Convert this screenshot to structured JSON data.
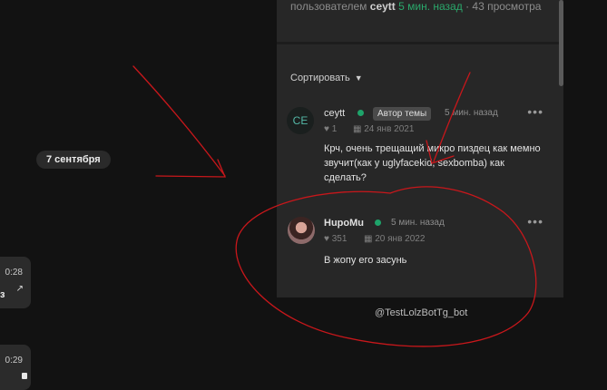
{
  "chat": {
    "date_label": "7 сентября",
    "messages": [
      {
        "time": "0:28",
        "fragment": "з",
        "arrow": "↗"
      },
      {
        "time": "0:29"
      }
    ]
  },
  "thread": {
    "meta_prefix": "пользователем",
    "meta_user": "ceytt",
    "meta_time": "5 мин. назад",
    "meta_views": "· 43 просмотра",
    "sort_label": "Сортировать",
    "comments": [
      {
        "avatar_initials": "CE",
        "username": "ceytt",
        "badge": "Автор темы",
        "time": "5 мин. назад",
        "likes": "1",
        "date": "24 янв 2021",
        "text": "Крч, очень трещащий микро пиздец как мемно звучит(как у uglyfacekid, sexbomba) как сделать?"
      },
      {
        "username": "HupoMu",
        "time": "5 мин. назад",
        "likes": "351",
        "date": "20 янв 2022",
        "text": "В жопу его засунь"
      }
    ]
  },
  "watermark": "@TestLolzBotTg_bot",
  "colors": {
    "online": "#1ea36a",
    "accent_green": "#2aa86b",
    "annotation": "#c8171b"
  }
}
